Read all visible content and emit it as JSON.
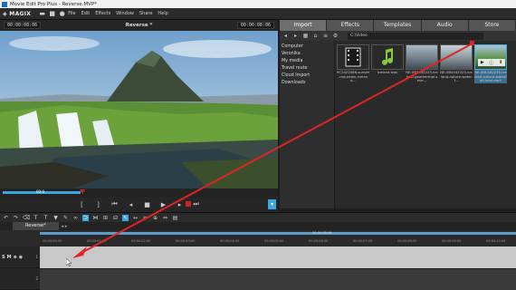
{
  "window": {
    "title": "Movie Edit Pro Plus - Reverse.MVP*"
  },
  "menubar": {
    "logo": "◈ MAGIX",
    "menus": [
      "File",
      "Edit",
      "Effects",
      "Window",
      "Share",
      "Help"
    ]
  },
  "preview": {
    "timecode_left": "00:00:08:06",
    "title": "Reverse *",
    "timecode_right": "00:00:08:06",
    "scrub_time": "00:0"
  },
  "media": {
    "tabs": [
      "Import",
      "Effects",
      "Templates",
      "Audio",
      "Store"
    ],
    "active_tab": "Import",
    "path": "C:\\Video",
    "sources": [
      "Computer",
      "Veronika",
      "My media",
      "Travel route",
      "Cloud Import",
      "Downloads"
    ],
    "files": [
      {
        "name": "0C2422066-sunset-mountain-iceland...",
        "type": "video-folder"
      },
      {
        "name": "Iceland.wav",
        "type": "audio"
      },
      {
        "name": "NE-0B4442223-iceland-geothermal-seve...",
        "type": "video"
      },
      {
        "name": "NE-0B4442224-iceland-nature-waterf...",
        "type": "video"
      },
      {
        "name": "NE-0BC442245-iceland-nature-waterfall-lumi.mp4",
        "type": "video",
        "selected": true
      }
    ]
  },
  "arrangement": {
    "tab": "Reverse*",
    "ruler_ticks": [
      "00:00:00:00",
      "00:00:01:00",
      "00:00:02:00",
      "00:00:03:00",
      "00:00:04:00",
      "00:00:05:00",
      "00:00:06:00",
      "00:00:07:00",
      "00:00:08:00",
      "00:00:09:00",
      "00:00:10:00"
    ],
    "playhead_time": "00:00:08:06"
  },
  "tracks": [
    {
      "s": "S",
      "m": "M",
      "number": "1"
    },
    {
      "s": "",
      "m": "",
      "number": "2"
    }
  ],
  "colors": {
    "accent": "#3aa7e0",
    "arrow": "#e02424",
    "track_bg": "#c8c8c8"
  }
}
